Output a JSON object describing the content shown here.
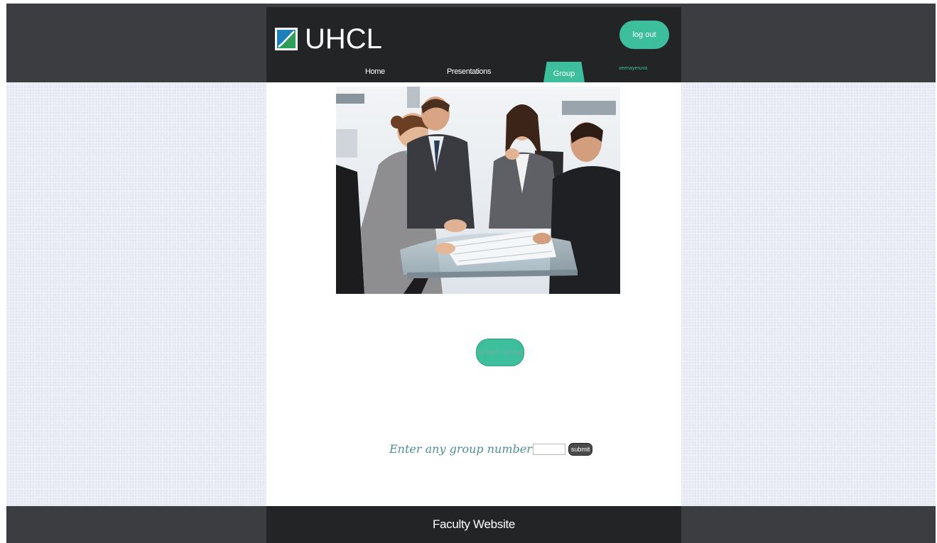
{
  "brand": {
    "name": "UHCL"
  },
  "header": {
    "logout_label": "log out",
    "nav": {
      "home": "Home",
      "presentations": "Presentations",
      "group": "Group"
    },
    "username": "veenayeruva"
  },
  "main": {
    "select_group_label": "Select Group",
    "group_prompt": "Enter any group number",
    "group_input_value": "",
    "submit_label": "submit"
  },
  "footer": {
    "text": "Faculty Website"
  },
  "colors": {
    "accent": "#3dbf9e",
    "header_bg": "#232426",
    "band_bg": "#3b3d41",
    "prompt_text": "#4f8f8f"
  }
}
